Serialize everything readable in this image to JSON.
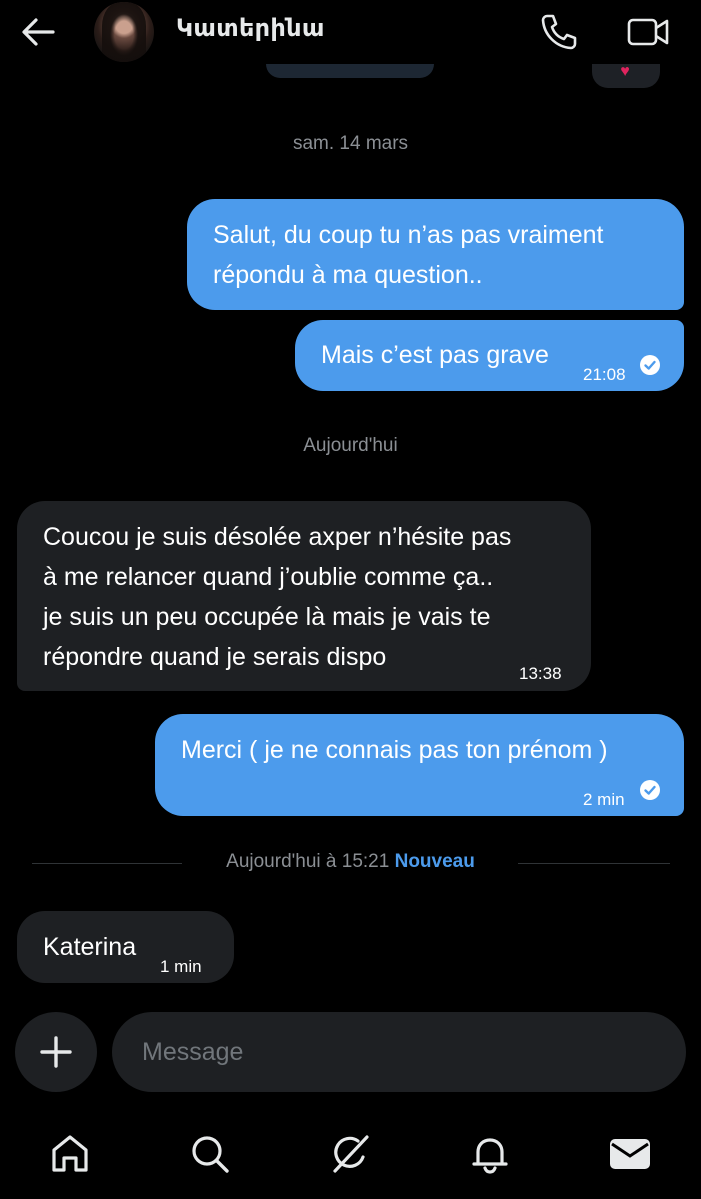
{
  "header": {
    "contact_name": "Կատերինա"
  },
  "messages": {
    "date1": "sam. 14 mars",
    "out1_line1": "Salut, du coup tu n’as pas vraiment",
    "out1_line2": "répondu à ma question..",
    "out2_text": "Mais c’est pas grave",
    "out2_time": "21:08",
    "date2": "Aujourd'hui",
    "in1_line1": "Coucou je suis désolée axper n’hésite pas",
    "in1_line2": "à me relancer quand j’oublie comme ça..",
    "in1_line3": "je suis un peu occupée là mais je vais te",
    "in1_line4": "répondre quand je serais dispo",
    "in1_time": "13:38",
    "out3_text": "Merci ( je ne connais pas ton prénom )",
    "out3_time": "2 min",
    "new_divider_time": "Aujourd'hui à 15:21",
    "new_divider_label": "Nouveau",
    "in2_text": "Katerina",
    "in2_time": "1 min"
  },
  "composer": {
    "placeholder": "Message"
  },
  "colors": {
    "accent": "#4c9bec",
    "incoming_bubble": "#1e2023",
    "background": "#000000"
  },
  "icons": {
    "back": "arrow-left-icon",
    "call": "phone-icon",
    "video": "video-camera-icon",
    "add": "plus-icon",
    "nav": [
      "home-icon",
      "search-icon",
      "grok-icon",
      "bell-icon",
      "mail-icon"
    ]
  }
}
